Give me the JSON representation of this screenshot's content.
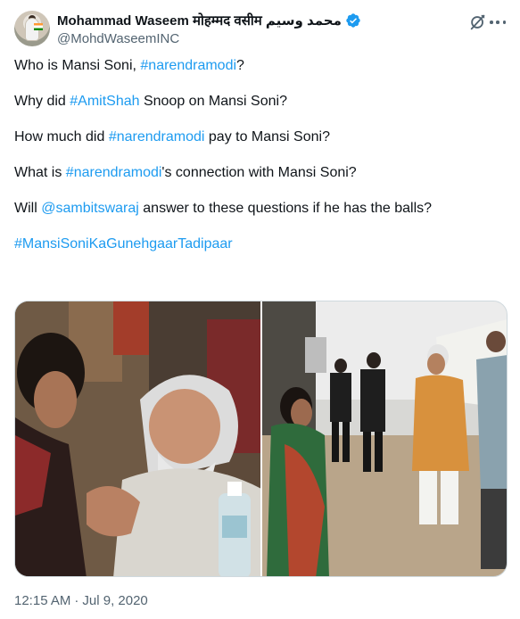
{
  "tweet": {
    "author": {
      "display_name": "Mohammad Waseem मोहम्मद वसीम محمد وسیم",
      "handle": "@MohdWaseemINC",
      "verified": true,
      "avatar_icon": "avatar-photo"
    },
    "header_icons": [
      "grok-icon",
      "more-icon"
    ],
    "paragraphs": [
      [
        {
          "t": "Who is Mansi Soni, "
        },
        {
          "t": "#narendramodi",
          "link": true
        },
        {
          "t": "?"
        }
      ],
      [
        {
          "t": "Why did "
        },
        {
          "t": "#AmitShah",
          "link": true
        },
        {
          "t": " Snoop on Mansi Soni?"
        }
      ],
      [
        {
          "t": "How much did "
        },
        {
          "t": "#narendramodi",
          "link": true
        },
        {
          "t": " pay to Mansi Soni?"
        }
      ],
      [
        {
          "t": "What is "
        },
        {
          "t": "#narendramodi",
          "link": true
        },
        {
          "t": "'s connection with Mansi Soni?"
        }
      ],
      [
        {
          "t": "Will "
        },
        {
          "t": "@sambitswaraj",
          "link": true
        },
        {
          "t": " answer to these questions if he has the balls?"
        }
      ],
      [
        {
          "t": "#MansiSoniKaGunehgaarTadipaar",
          "link": true
        }
      ]
    ],
    "media": [
      "photo-1",
      "photo-2"
    ],
    "timestamp": {
      "time": "12:15 AM",
      "separator": "·",
      "date": "Jul 9, 2020"
    }
  },
  "colors": {
    "text": "#0f1419",
    "secondary": "#536471",
    "link": "#1d9bf0",
    "border": "#cfd9de"
  }
}
